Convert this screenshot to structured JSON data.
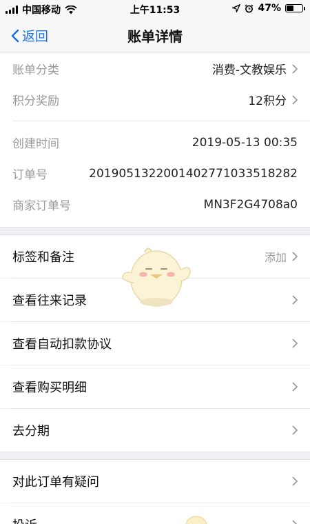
{
  "status": {
    "carrier": "中国移动",
    "time": "上午11:53",
    "battery": "47%",
    "battery_level": 0.47
  },
  "nav": {
    "back_label": "返回",
    "title": "账单详情"
  },
  "summary": [
    {
      "label": "账单分类",
      "value": "消费-文教娱乐",
      "chevron": true
    },
    {
      "label": "积分奖励",
      "value": "12积分",
      "chevron": true
    }
  ],
  "details": [
    {
      "label": "创建时间",
      "value": "2019-05-13 00:35"
    },
    {
      "label": "订单号",
      "value": "20190513220014027710335182 82"
    },
    {
      "label": "商家订单号",
      "value": "MN3F2G4708a0"
    }
  ],
  "actions": [
    {
      "label": "标签和备注",
      "hint": "添加"
    },
    {
      "label": "查看往来记录",
      "hint": ""
    },
    {
      "label": "查看自动扣款协议",
      "hint": ""
    },
    {
      "label": "查看购买明细",
      "hint": ""
    },
    {
      "label": "去分期",
      "hint": ""
    }
  ],
  "support": [
    {
      "label": "对此订单有疑问"
    },
    {
      "label": "投诉"
    }
  ],
  "colors": {
    "accent": "#1a73e8",
    "muted": "#9a9a9a",
    "background": "#efeff4"
  }
}
